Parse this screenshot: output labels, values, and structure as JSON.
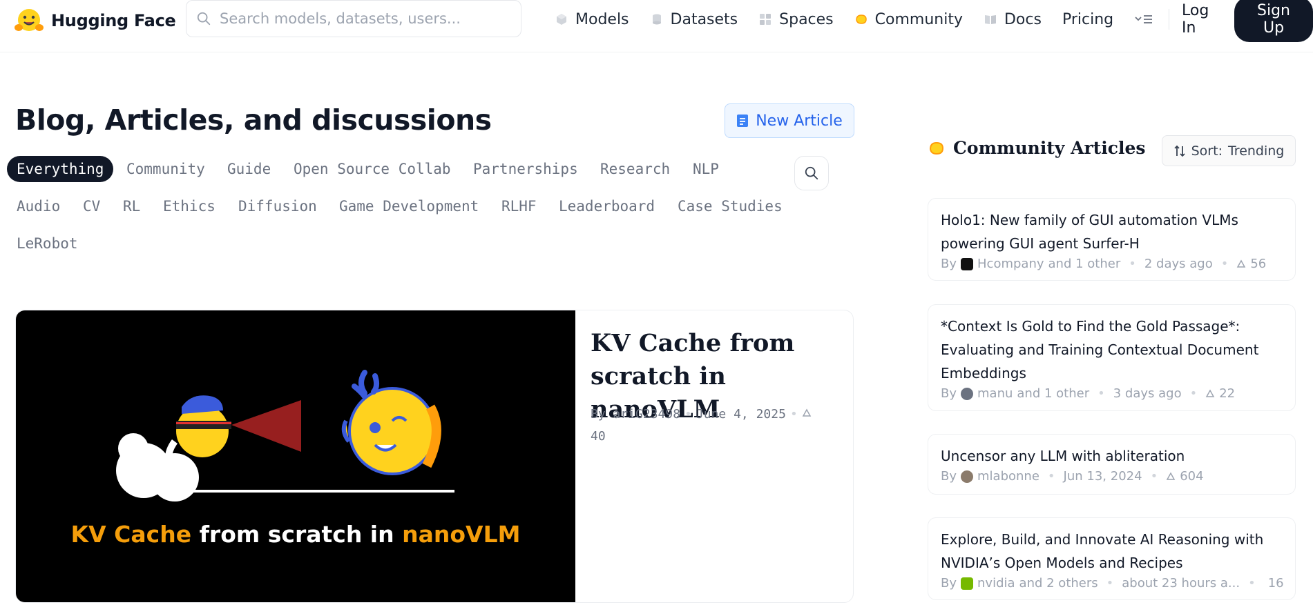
{
  "header": {
    "logo_text": "Hugging Face",
    "search_placeholder": "Search models, datasets, users...",
    "nav": [
      {
        "label": "Models",
        "icon": "models-icon"
      },
      {
        "label": "Datasets",
        "icon": "datasets-icon"
      },
      {
        "label": "Spaces",
        "icon": "spaces-icon"
      },
      {
        "label": "Community",
        "icon": "community-icon"
      },
      {
        "label": "Docs",
        "icon": "docs-icon"
      },
      {
        "label": "Pricing"
      }
    ],
    "login": "Log In",
    "signup": "Sign Up"
  },
  "main": {
    "title": "Blog, Articles, and discussions",
    "new_article": "New Article",
    "tabs": [
      "Everything",
      "Community",
      "Guide",
      "Open Source Collab",
      "Partnerships",
      "Research",
      "NLP",
      "Audio",
      "CV",
      "RL",
      "Ethics",
      "Diffusion",
      "Game Development",
      "RLHF",
      "Leaderboard",
      "Case Studies",
      "LeRobot"
    ],
    "active_tab": "Everything",
    "featured": {
      "image_caption_part1": "KV Cache",
      "image_caption_part2": " from scratch in ",
      "image_caption_part3": "nanoVLM",
      "title": "KV Cache from scratch in nanoVLM",
      "author": "By ariG23498",
      "date": "June 4, 2025",
      "upvotes": "40"
    }
  },
  "sidebar": {
    "title": "Community Articles",
    "sort_label": "Sort:",
    "sort_value": "Trending",
    "articles": [
      {
        "title": "Holo1: New family of GUI automation VLMs powering GUI agent Surfer-H",
        "by": "By",
        "author": "Hcompany",
        "others": "and 1 other",
        "date": "2 days ago",
        "upvotes": "56",
        "avatar_color": "#111111"
      },
      {
        "title": "*Context Is Gold to Find the Gold Passage*: Evaluating and Training Contextual Document Embeddings",
        "by": "By",
        "author": "manu",
        "others": "and 1 other",
        "date": "3 days ago",
        "upvotes": "22",
        "avatar_color": "#6b7280"
      },
      {
        "title": "Uncensor any LLM with abliteration",
        "by": "By",
        "author": "mlabonne",
        "others": "",
        "date": "Jun 13, 2024",
        "upvotes": "604",
        "avatar_color": "#8b7b6b"
      },
      {
        "title": "Explore, Build, and Innovate AI Reasoning with NVIDIA’s Open Models and Recipes",
        "by": "By",
        "author": "nvidia",
        "others": "and 2 others",
        "date": "about 23 hours a...",
        "upvotes": "16",
        "avatar_color": "#76b900"
      }
    ]
  }
}
